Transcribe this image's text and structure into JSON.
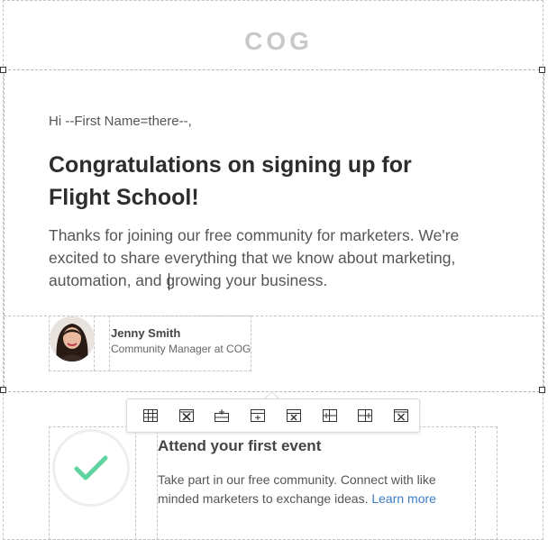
{
  "header": {
    "logo_text": "COG"
  },
  "content": {
    "greeting": "Hi --First Name=there--,",
    "headline": "Congratulations on signing up for Flight School!",
    "body": "Thanks for joining our free community for marketers. We're excited to share everything that we know about marketing, automation, and growing your business."
  },
  "signature": {
    "name": "Jenny Smith",
    "title": "Community Manager at COG"
  },
  "toolbar": {
    "buttons": [
      {
        "icon": "table-icon"
      },
      {
        "icon": "delete-table-icon"
      },
      {
        "icon": "insert-row-above-icon"
      },
      {
        "icon": "insert-row-below-icon"
      },
      {
        "icon": "delete-row-icon"
      },
      {
        "icon": "insert-column-left-icon"
      },
      {
        "icon": "insert-column-right-icon"
      },
      {
        "icon": "delete-column-icon"
      }
    ]
  },
  "event": {
    "title": "Attend your first event",
    "description": "Take part in our free community. Connect with like minded marketers to exchange ideas.",
    "link_text": "Learn more"
  },
  "colors": {
    "check": "#5fd4a0",
    "link": "#3b7cc4",
    "logo": "#c8c8c8"
  }
}
